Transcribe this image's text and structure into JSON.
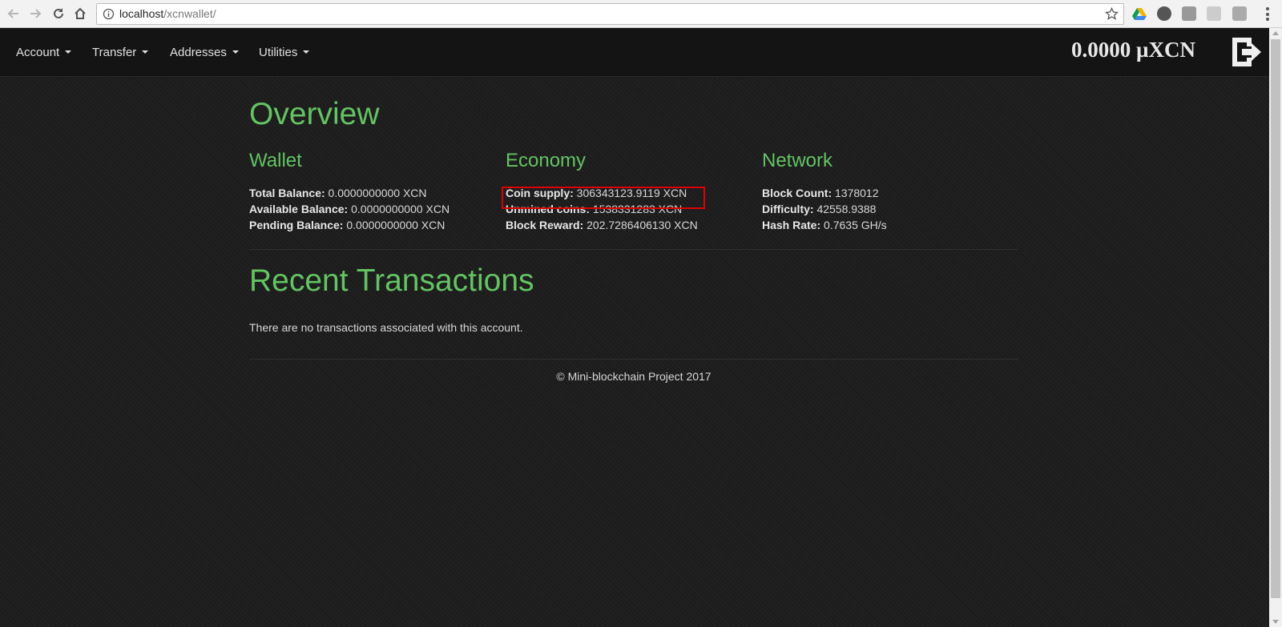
{
  "browser": {
    "url_host": "localhost",
    "url_path": "/xcnwallet/"
  },
  "navbar": {
    "menus": [
      {
        "label": "Account"
      },
      {
        "label": "Transfer"
      },
      {
        "label": "Addresses"
      },
      {
        "label": "Utilities"
      }
    ],
    "balance": "0.0000 µXCN"
  },
  "overview": {
    "title": "Overview",
    "wallet": {
      "heading": "Wallet",
      "rows": [
        {
          "label": "Total Balance:",
          "value": "0.0000000000 XCN"
        },
        {
          "label": "Available Balance:",
          "value": "0.0000000000 XCN"
        },
        {
          "label": "Pending Balance:",
          "value": "0.0000000000 XCN"
        }
      ]
    },
    "economy": {
      "heading": "Economy",
      "rows": [
        {
          "label": "Coin supply:",
          "value": "306343123.9119 XCN"
        },
        {
          "label": "Unmined coins:",
          "value": "1538331283 XCN"
        },
        {
          "label": "Block Reward:",
          "value": "202.7286406130 XCN"
        }
      ]
    },
    "network": {
      "heading": "Network",
      "rows": [
        {
          "label": "Block Count:",
          "value": "1378012"
        },
        {
          "label": "Difficulty:",
          "value": "42558.9388"
        },
        {
          "label": "Hash Rate:",
          "value": "0.7635 GH/s"
        }
      ]
    }
  },
  "transactions": {
    "title": "Recent Transactions",
    "empty_message": "There are no transactions associated with this account."
  },
  "footer": {
    "text": "© Mini-blockchain Project 2017"
  },
  "colors": {
    "accent_green": "#62c462",
    "highlight_red": "#e00000",
    "navbar_bg": "#141414"
  }
}
